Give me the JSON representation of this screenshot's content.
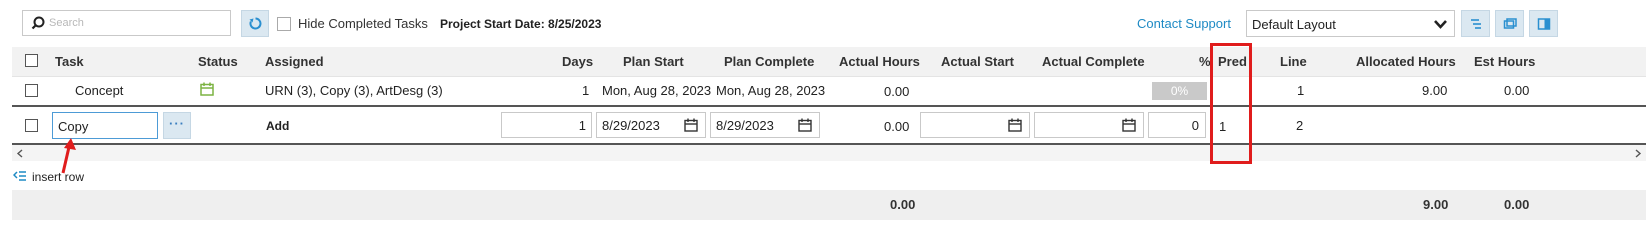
{
  "toolbar": {
    "search_placeholder": "Search",
    "hide_completed_label": "Hide Completed Tasks",
    "project_start": "Project Start Date: 8/25/2023",
    "contact_support": "Contact Support",
    "layout_selected": "Default Layout"
  },
  "columns": {
    "task": "Task",
    "status": "Status",
    "assigned": "Assigned",
    "days": "Days",
    "plan_start": "Plan Start",
    "plan_complete": "Plan Complete",
    "actual_hours": "Actual Hours",
    "actual_start": "Actual Start",
    "actual_complete": "Actual Complete",
    "percent": "%",
    "pred": "Pred",
    "line": "Line",
    "allocated_hours": "Allocated Hours",
    "est_hours": "Est Hours"
  },
  "rows": [
    {
      "task": "Concept",
      "assigned": "URN (3), Copy (3), ArtDesg (3)",
      "days": "1",
      "plan_start": "Mon, Aug 28, 2023",
      "plan_complete": "Mon, Aug 28, 2023",
      "actual_hours": "0.00",
      "percent": "0%",
      "line": "1",
      "allocated_hours": "9.00",
      "est_hours": "0.00"
    },
    {
      "task": "Copy",
      "assigned": "Add",
      "days": "1",
      "plan_start": "8/29/2023",
      "plan_complete": "8/29/2023",
      "actual_hours": "0.00",
      "actual_start": "",
      "actual_complete": "",
      "percent": "0",
      "pred": "1",
      "line": "2"
    }
  ],
  "insert_row": "insert row",
  "totals": {
    "actual_hours": "0.00",
    "allocated_hours": "9.00",
    "est_hours": "0.00"
  },
  "colors": {
    "accent": "#1e8ac4",
    "annotation": "#e01c1c",
    "status_icon": "#7cb342"
  }
}
